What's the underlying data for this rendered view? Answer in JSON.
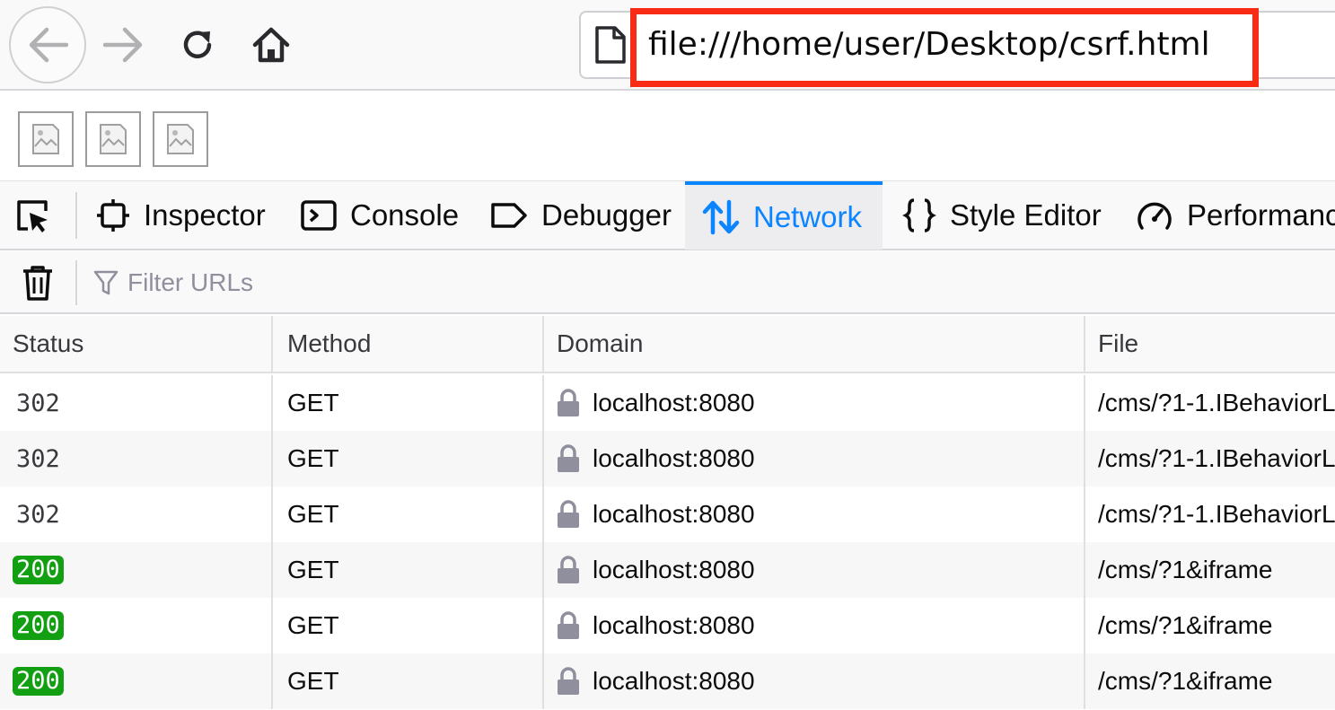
{
  "browser": {
    "url": "file:///home/user/Desktop/csrf.html",
    "highlight_color": "#fa2b15"
  },
  "devtools": {
    "tabs": [
      {
        "label": "Inspector",
        "icon": "inspector-icon"
      },
      {
        "label": "Console",
        "icon": "console-icon"
      },
      {
        "label": "Debugger",
        "icon": "debugger-icon"
      },
      {
        "label": "Network",
        "icon": "network-icon",
        "selected": true
      },
      {
        "label": "Style Editor",
        "icon": "style-editor-icon"
      },
      {
        "label": "Performance",
        "icon": "performance-icon"
      }
    ],
    "accent_color": "#0a84ff",
    "filter_placeholder": "Filter URLs"
  },
  "network": {
    "columns": {
      "status": "Status",
      "method": "Method",
      "domain": "Domain",
      "file": "File"
    },
    "requests": [
      {
        "status": "302",
        "method": "GET",
        "domain": "localhost:8080",
        "file": "/cms/?1-1.IBehaviorL"
      },
      {
        "status": "302",
        "method": "GET",
        "domain": "localhost:8080",
        "file": "/cms/?1-1.IBehaviorL"
      },
      {
        "status": "302",
        "method": "GET",
        "domain": "localhost:8080",
        "file": "/cms/?1-1.IBehaviorL"
      },
      {
        "status": "200",
        "method": "GET",
        "domain": "localhost:8080",
        "file": "/cms/?1&iframe"
      },
      {
        "status": "200",
        "method": "GET",
        "domain": "localhost:8080",
        "file": "/cms/?1&iframe"
      },
      {
        "status": "200",
        "method": "GET",
        "domain": "localhost:8080",
        "file": "/cms/?1&iframe"
      }
    ],
    "status_ok_color": "#12a012"
  }
}
